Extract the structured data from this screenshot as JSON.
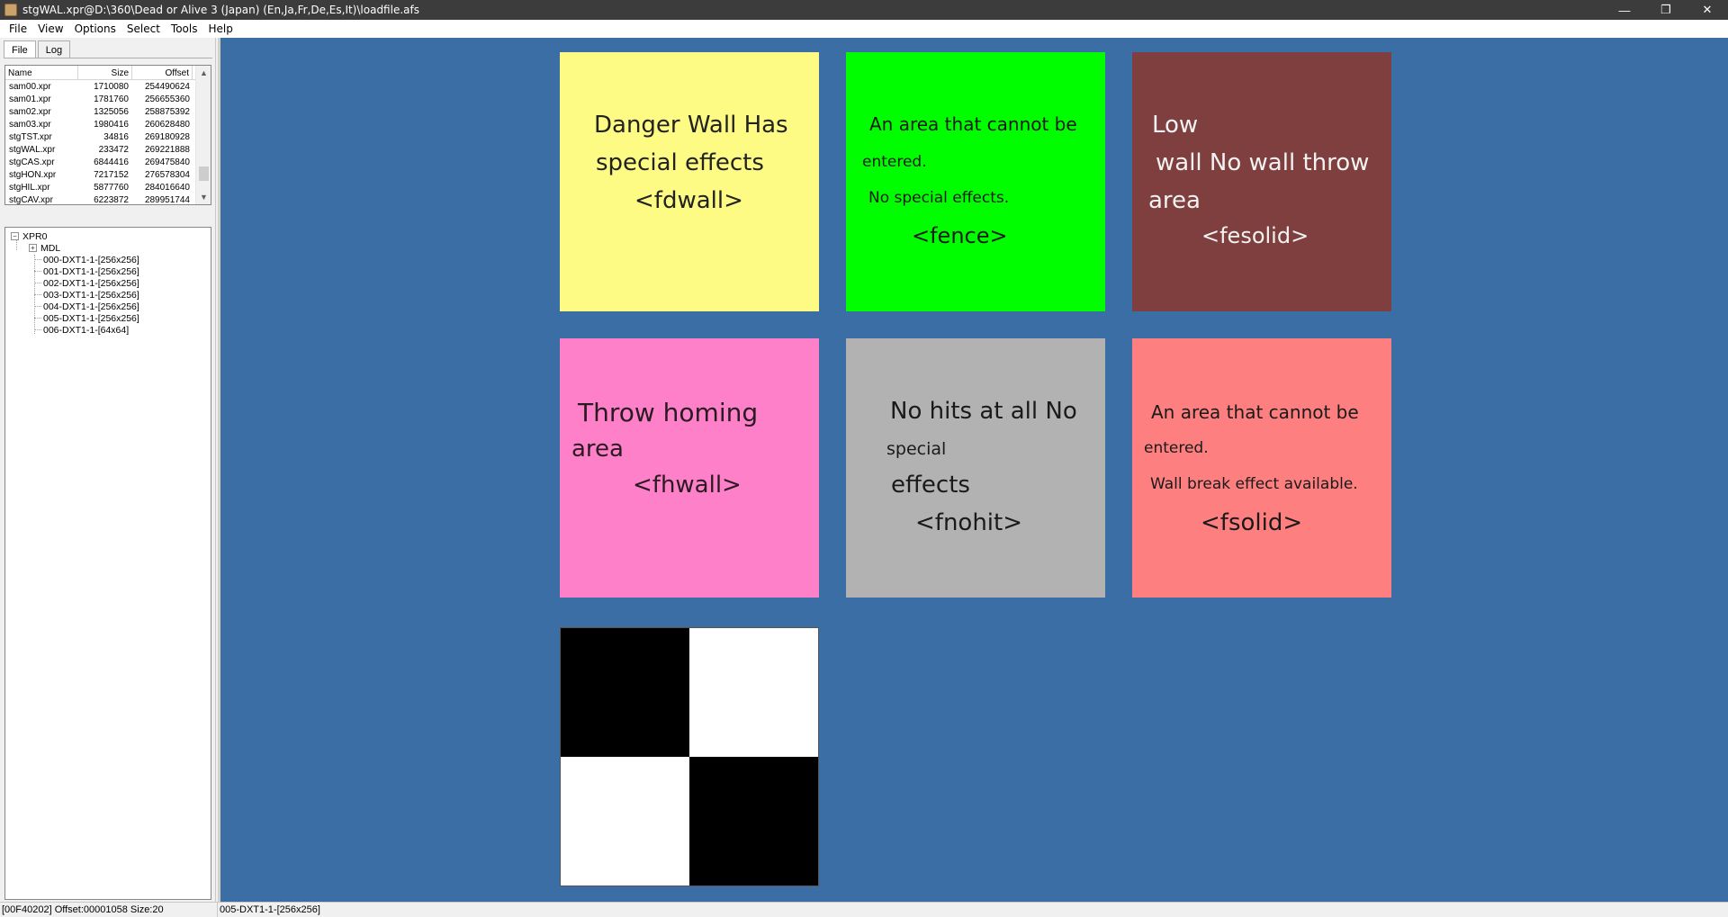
{
  "window": {
    "title": "stgWAL.xpr@D:\\360\\Dead or Alive 3 (Japan) (En,Ja,Fr,De,Es,It)\\loadfile.afs",
    "minimize": "—",
    "maximize": "❐",
    "close": "✕"
  },
  "menu": [
    "File",
    "View",
    "Options",
    "Select",
    "Tools",
    "Help"
  ],
  "tabs": {
    "file": "File",
    "log": "Log"
  },
  "filelist": {
    "headers": {
      "name": "Name",
      "size": "Size",
      "offset": "Offset"
    },
    "rows": [
      {
        "name": "sam00.xpr",
        "size": "1710080",
        "offset": "254490624"
      },
      {
        "name": "sam01.xpr",
        "size": "1781760",
        "offset": "256655360"
      },
      {
        "name": "sam02.xpr",
        "size": "1325056",
        "offset": "258875392"
      },
      {
        "name": "sam03.xpr",
        "size": "1980416",
        "offset": "260628480"
      },
      {
        "name": "stgTST.xpr",
        "size": "34816",
        "offset": "269180928"
      },
      {
        "name": "stgWAL.xpr",
        "size": "233472",
        "offset": "269221888"
      },
      {
        "name": "stgCAS.xpr",
        "size": "6844416",
        "offset": "269475840"
      },
      {
        "name": "stgHON.xpr",
        "size": "7217152",
        "offset": "276578304"
      },
      {
        "name": "stgHIL.xpr",
        "size": "5877760",
        "offset": "284016640"
      },
      {
        "name": "stgCAV.xpr",
        "size": "6223872",
        "offset": "289951744"
      }
    ],
    "scroll_up": "▲",
    "scroll_down": "▼"
  },
  "tree": {
    "root": "XPR0",
    "root_expander": "−",
    "mdl": "MDL",
    "mdl_expander": "+",
    "children": [
      "000-DXT1-1-[256x256]",
      "001-DXT1-1-[256x256]",
      "002-DXT1-1-[256x256]",
      "003-DXT1-1-[256x256]",
      "004-DXT1-1-[256x256]",
      "005-DXT1-1-[256x256]",
      "006-DXT1-1-[64x64]"
    ]
  },
  "textures": [
    {
      "bg": "#fefb84",
      "color": "#222222",
      "lines": [
        "Danger Wall Has",
        "special effects",
        "<fdwall>"
      ]
    },
    {
      "bg": "#00fe00",
      "color": "#1a1a1a",
      "lines": [
        "An area that cannot be",
        "entered.",
        "No special effects.",
        "<fence>"
      ]
    },
    {
      "bg": "#7f3f3f",
      "color": "#f2f2f2",
      "lines": [
        "Low",
        "wall No wall throw",
        "area",
        "<fesolid>"
      ]
    },
    {
      "bg": "#fe80c8",
      "color": "#2a1a22",
      "lines": [
        "Throw homing",
        "area",
        "<fhwall>"
      ]
    },
    {
      "bg": "#b2b2b2",
      "color": "#1a1a1a",
      "lines": [
        "No hits at all No",
        "special",
        "effects",
        "<fnohit>"
      ]
    },
    {
      "bg": "#fe7f7f",
      "color": "#1a1a1a",
      "lines": [
        "An area that cannot be",
        "entered.",
        "Wall break effect available.",
        "<fsolid>"
      ]
    }
  ],
  "checker": {
    "dark": "#000000",
    "light": "#ffffff"
  },
  "status": {
    "left": "[00F40202] Offset:00001058 Size:20",
    "right": "005-DXT1-1-[256x256]"
  },
  "colors": {
    "viewer_bg": "#3a6ea5",
    "titlebar_bg": "#3c3c3c"
  }
}
